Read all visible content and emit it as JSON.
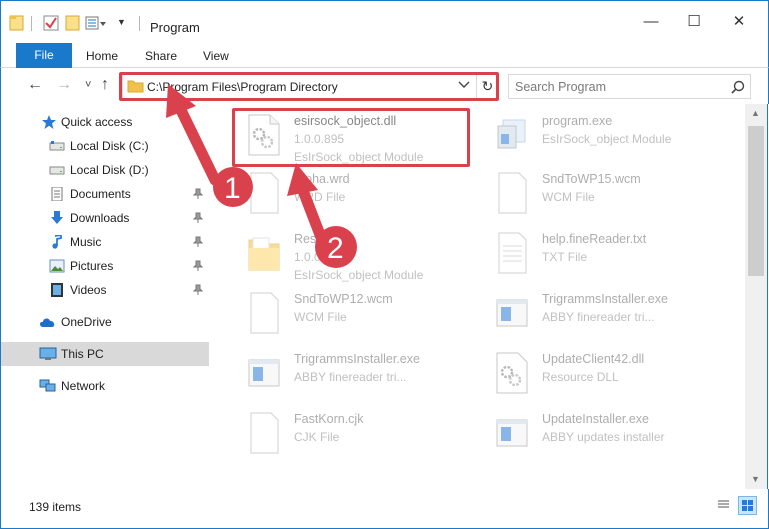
{
  "window": {
    "title": "Program",
    "controls": {
      "minimize": "—",
      "maximize": "☐",
      "close": "✕"
    }
  },
  "ribbon": {
    "tabs": [
      {
        "label": "File"
      },
      {
        "label": "Home"
      },
      {
        "label": "Share"
      },
      {
        "label": "View"
      }
    ]
  },
  "address": {
    "path": "C:\\Program Files\\Program Directory",
    "refresh_icon": "↻"
  },
  "search": {
    "placeholder": "Search Program"
  },
  "nav": {
    "back": "←",
    "forward": "→",
    "recent": "˅",
    "up": "↑"
  },
  "sidebar": {
    "items": [
      {
        "label": "Quick access",
        "icon": "star-icon"
      },
      {
        "label": "Local Disk (C:)",
        "icon": "drive-icon",
        "pinned": true
      },
      {
        "label": "Local Disk (D:)",
        "icon": "drive-icon",
        "pinned": false
      },
      {
        "label": "Documents",
        "icon": "documents-icon",
        "pinned": true
      },
      {
        "label": "Downloads",
        "icon": "download-icon",
        "pinned": true
      },
      {
        "label": "Music",
        "icon": "music-icon",
        "pinned": true
      },
      {
        "label": "Pictures",
        "icon": "pictures-icon",
        "pinned": true
      },
      {
        "label": "Videos",
        "icon": "videos-icon",
        "pinned": true
      },
      {
        "label": "OneDrive",
        "icon": "cloud-icon"
      },
      {
        "label": "This PC",
        "icon": "computer-icon",
        "selected": true
      },
      {
        "label": "Network",
        "icon": "network-icon"
      }
    ]
  },
  "files": [
    {
      "name": "esirsock_object.dll",
      "line1": "1.0.0.895",
      "line2": "EsIrSock_object Module",
      "icon": "dll-gear-icon",
      "highlight": true
    },
    {
      "name": "program.exe",
      "line1": "EsIrSock_object Module",
      "line2": "",
      "icon": "exe-icon"
    },
    {
      "name": "Alpha.wrd",
      "line1": "WRD File",
      "line2": "",
      "icon": "blank-file-icon"
    },
    {
      "name": "SndToWP15.wcm",
      "line1": "WCM File",
      "line2": "",
      "icon": "blank-file-icon"
    },
    {
      "name": "Resource",
      "line1": "1.0.0.895",
      "line2": "EsIrSock_object Module",
      "icon": "folder-icon"
    },
    {
      "name": "help.fineReader.txt",
      "line1": "TXT File",
      "line2": "",
      "icon": "text-file-icon"
    },
    {
      "name": "SndToWP12.wcm",
      "line1": "WCM File",
      "line2": "",
      "icon": "blank-file-icon"
    },
    {
      "name": "TrigrammsInstaller.exe",
      "line1": "ABBY finereader tri...",
      "line2": "",
      "icon": "installer-icon"
    },
    {
      "name": "TrigrammsInstaller.exe",
      "line1": "ABBY finereader tri...",
      "line2": "",
      "icon": "installer-icon"
    },
    {
      "name": "UpdateClient42.dll",
      "line1": "Resource DLL",
      "line2": "",
      "icon": "dll-gear-icon"
    },
    {
      "name": "FastKorn.cjk",
      "line1": "CJK File",
      "line2": "",
      "icon": "blank-file-icon"
    },
    {
      "name": "UpdateInstaller.exe",
      "line1": "ABBY updates installer",
      "line2": "",
      "icon": "installer-icon"
    }
  ],
  "status": {
    "item_count": "139 items"
  },
  "annotations": {
    "step1": "1",
    "step2": "2"
  },
  "colors": {
    "accent": "#1979ca",
    "annotation_red": "#d9414c",
    "folder_yellow": "#f0c14b"
  }
}
